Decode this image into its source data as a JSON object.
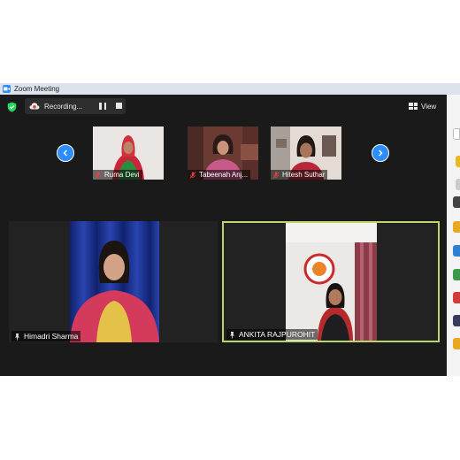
{
  "window": {
    "title": "Zoom Meeting"
  },
  "toolbar": {
    "recording_label": "Recording...",
    "view_label": "View"
  },
  "gallery": {
    "thumbnails": [
      {
        "name": "Ruma Devi"
      },
      {
        "name": "Tabeenah Anj..."
      },
      {
        "name": "Hitesh Suthar"
      }
    ]
  },
  "participants": [
    {
      "name": "Himadri Sharma"
    },
    {
      "name": "ANKITA RAJPUROHIT"
    }
  ],
  "colors": {
    "accent": "#2d8cff",
    "active_speaker_border": "#b9d66c",
    "meeting_bg": "#1a1a1a",
    "muted_mic": "#e0443e",
    "shield": "#23d959"
  },
  "icons": [
    "zoom-app-icon",
    "shield-icon",
    "cloud-record-icon",
    "pause-icon",
    "stop-icon",
    "grid-view-icon",
    "chevron-left-icon",
    "chevron-right-icon",
    "mic-muted-icon",
    "pin-icon"
  ]
}
